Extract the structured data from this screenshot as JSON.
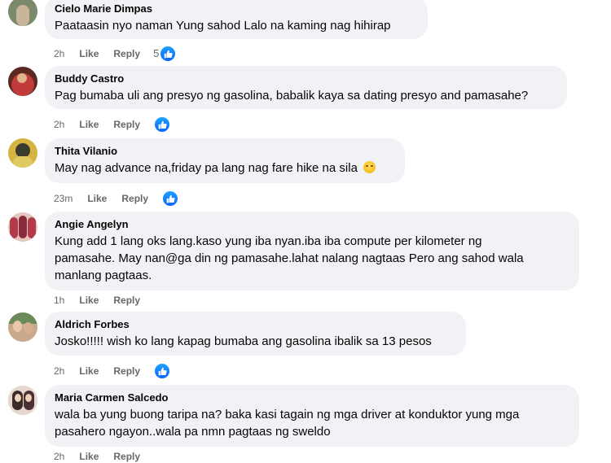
{
  "comments": [
    {
      "author": "Cielo Marie Dimpas",
      "text_lines": [
        "Paataasin nyo naman Yung sahod Lalo na kaming nag hihirap"
      ],
      "time": "2h",
      "like": "Like",
      "reply": "Reply",
      "reaction_count": "5",
      "avatar_colors": [
        "#7a8a6a",
        "#c9b59a"
      ]
    },
    {
      "author": "Buddy Castro",
      "text_lines": [
        "Pag bumaba uli ang presyo ng gasolina, babalik kaya sa dating presyo and pamasahe?"
      ],
      "time": "2h",
      "like": "Like",
      "reply": "Reply",
      "reaction_count": "",
      "avatar_colors": [
        "#c23b3b",
        "#5a2a22"
      ]
    },
    {
      "author": "Thita Vilanio",
      "text_lines": [
        "May nag advance na,friday pa lang nag fare hike na sila"
      ],
      "emoji": "sad-face-emoji",
      "time": "23m",
      "like": "Like",
      "reply": "Reply",
      "reaction_count": "",
      "avatar_colors": [
        "#d6b341",
        "#3b3b2e"
      ]
    },
    {
      "author": "Angie Angelyn",
      "text_lines": [
        "Kung add 1 lang oks lang.kaso yung iba nyan.iba iba compute per kilometer ng",
        "pamasahe. May nan@ga din ng pamasahe.lahat nalang nagtaas Pero ang sahod wala",
        "manlang pagtaas."
      ],
      "time": "1h",
      "like": "Like",
      "reply": "Reply",
      "reaction_count": "",
      "avatar_colors": [
        "#b23a4a",
        "#e6c7c0"
      ]
    },
    {
      "author": "Aldrich Forbes",
      "text_lines": [
        "Josko!!!!! wish ko lang kapag bumaba ang gasolina ibalik sa 13 pesos"
      ],
      "time": "2h",
      "like": "Like",
      "reply": "Reply",
      "reaction_count": "",
      "avatar_colors": [
        "#c9a98a",
        "#6a8a5a"
      ]
    },
    {
      "author": "Maria Carmen Salcedo",
      "text_lines": [
        "wala ba yung buong taripa na? baka kasi tagain ng mga driver at konduktor yung mga",
        "pasahero ngayon..wala pa nmn pagtaas ng sweldo"
      ],
      "time": "2h",
      "like": "Like",
      "reply": "Reply",
      "reaction_count": "",
      "avatar_colors": [
        "#e8d6d0",
        "#3a2a2a"
      ]
    }
  ],
  "colors": {
    "bubble": "#f0f2f5",
    "meta": "#65676b",
    "like_blue": "#0866ff"
  }
}
